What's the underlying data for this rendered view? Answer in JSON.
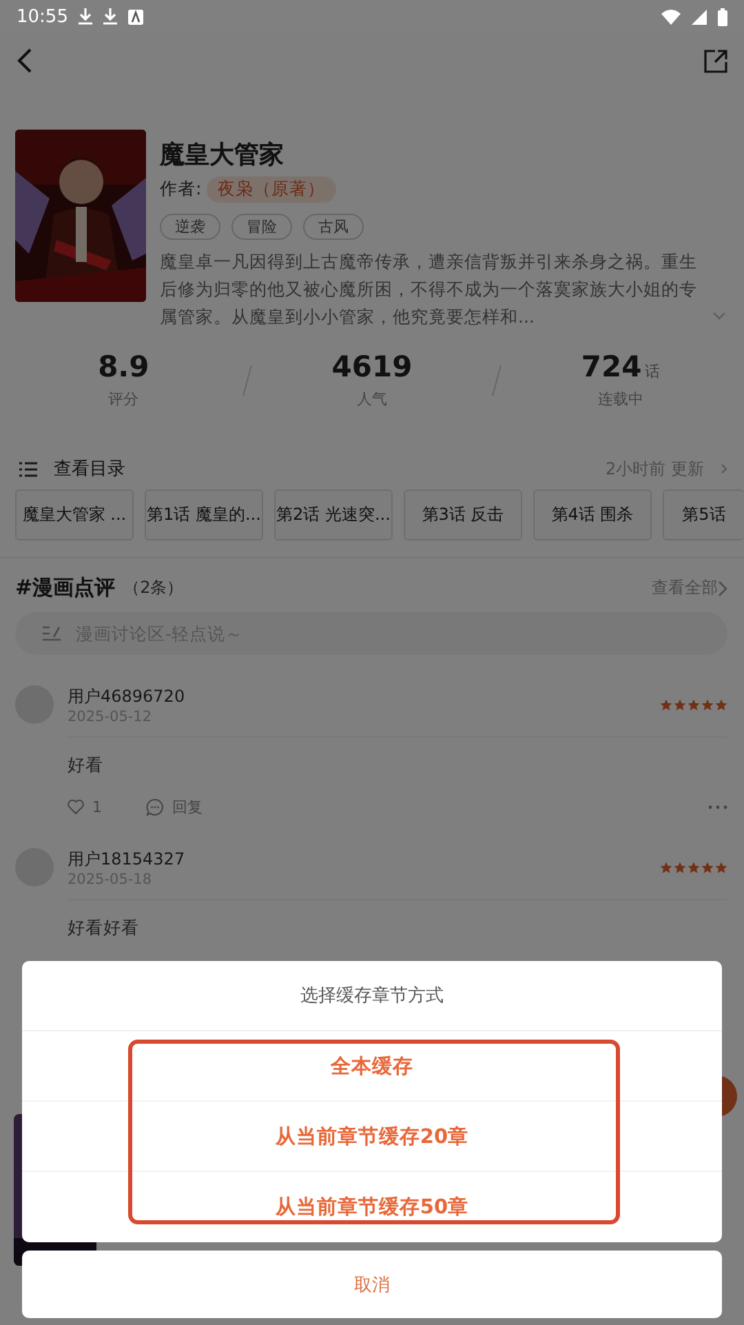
{
  "status_bar": {
    "time": "10:55"
  },
  "book": {
    "title": "魔皇大管家",
    "author_label": "作者:",
    "author": "夜枭（原著）",
    "tags": [
      "逆袭",
      "冒险",
      "古风"
    ],
    "description": "魔皇卓一凡因得到上古魔帝传承，遭亲信背叛并引来杀身之祸。重生后修为归零的他又被心魔所困，不得不成为一个落寞家族大小姐的专属管家。从魔皇到小小管家，他究竟要怎样和..."
  },
  "stats": [
    {
      "value": "8.9",
      "label": "评分"
    },
    {
      "value": "4619",
      "label": "人气"
    },
    {
      "value": "724",
      "unit": "话",
      "label": "连载中"
    }
  ],
  "catalog": {
    "label": "查看目录",
    "updated": "2小时前 更新",
    "chapters": [
      "魔皇大管家 ...",
      "第1话 魔皇的...",
      "第2话 光速突...",
      "第3话 反击",
      "第4话 围杀",
      "第5话"
    ]
  },
  "reviews": {
    "title": "#漫画点评",
    "count": "（2条）",
    "view_all": "查看全部",
    "placeholder": "漫画讨论区-轻点说～",
    "comments": [
      {
        "user": "用户46896720",
        "date": "2025-05-12",
        "stars": 5,
        "text": "好看",
        "likes": "1",
        "reply": "回复"
      },
      {
        "user": "用户18154327",
        "date": "2025-05-18",
        "stars": 5,
        "text": "好看好看"
      }
    ]
  },
  "dialog": {
    "title": "选择缓存章节方式",
    "options": [
      "全本缓存",
      "从当前章节缓存20章",
      "从当前章节缓存50章"
    ],
    "cancel": "取消"
  }
}
